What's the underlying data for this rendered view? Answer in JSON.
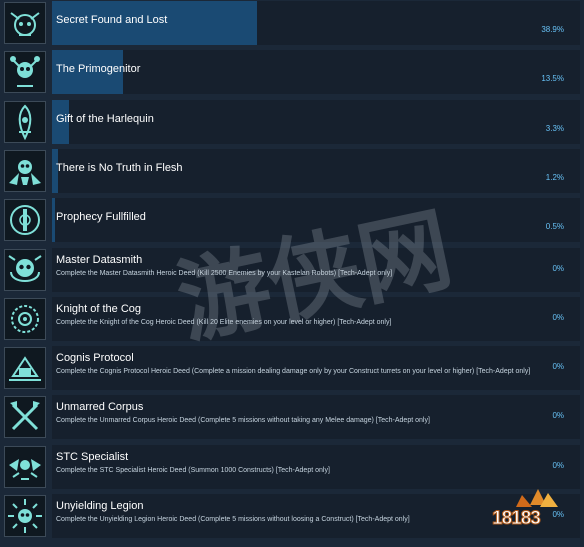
{
  "achievements": [
    {
      "title": "Secret Found and Lost",
      "description": "",
      "percent": "38.9%",
      "percent_value": 38.9,
      "icon": "skull-banner-icon"
    },
    {
      "title": "The Primogenitor",
      "description": "",
      "percent": "13.5%",
      "percent_value": 13.5,
      "icon": "skull-mace-icon"
    },
    {
      "title": "Gift of the Harlequin",
      "description": "",
      "percent": "3.3%",
      "percent_value": 3.3,
      "icon": "harlequin-mask-icon"
    },
    {
      "title": "There is No Truth in Flesh",
      "description": "",
      "percent": "1.2%",
      "percent_value": 1.2,
      "icon": "winged-skull-icon"
    },
    {
      "title": "Prophecy Fullfilled",
      "description": "",
      "percent": "0.5%",
      "percent_value": 0.5,
      "icon": "prophecy-emblem-icon"
    },
    {
      "title": "Master Datasmith",
      "description": "Complete the Master Datasmith Heroic Deed (Kill 2500 Enemies by your Kastelan Robots) [Tech-Adept only]",
      "percent": "0%",
      "percent_value": 0,
      "icon": "datasmith-skull-icon"
    },
    {
      "title": "Knight of the Cog",
      "description": "Complete the Knight of the Cog Heroic Deed (Kill 20 Elite enemies on your level or higher) [Tech-Adept only]",
      "percent": "0%",
      "percent_value": 0,
      "icon": "cog-emblem-icon"
    },
    {
      "title": "Cognis Protocol",
      "description": "Complete the Cognis Protocol Heroic Deed (Complete a mission dealing damage only by your Construct turrets on your level or higher) [Tech-Adept only]",
      "percent": "0%",
      "percent_value": 0,
      "icon": "turret-emblem-icon"
    },
    {
      "title": "Unmarred Corpus",
      "description": "Complete the Unmarred Corpus Heroic Deed (Complete 5 missions without taking any Melee damage) [Tech-Adept only]",
      "percent": "0%",
      "percent_value": 0,
      "icon": "crossed-axes-icon"
    },
    {
      "title": "STC Specialist",
      "description": "Complete the STC Specialist Heroic Deed (Summon 1000 Constructs) [Tech-Adept only]",
      "percent": "0%",
      "percent_value": 0,
      "icon": "winged-constructs-icon"
    },
    {
      "title": "Unyielding Legion",
      "description": "Complete the Unyielding Legion Heroic Deed (Complete 5 missions without loosing a Construct) [Tech-Adept only]",
      "percent": "0%",
      "percent_value": 0,
      "icon": "sunburst-skull-icon"
    }
  ],
  "watermark": {
    "text": "游侠网"
  },
  "site_logo": {
    "text": "18183"
  },
  "colors": {
    "background": "#1b2838",
    "panel": "#16202d",
    "progress_fill": "#1a4a73",
    "percent_text": "#67c1f5",
    "icon_glow": "#7fe0d8"
  }
}
